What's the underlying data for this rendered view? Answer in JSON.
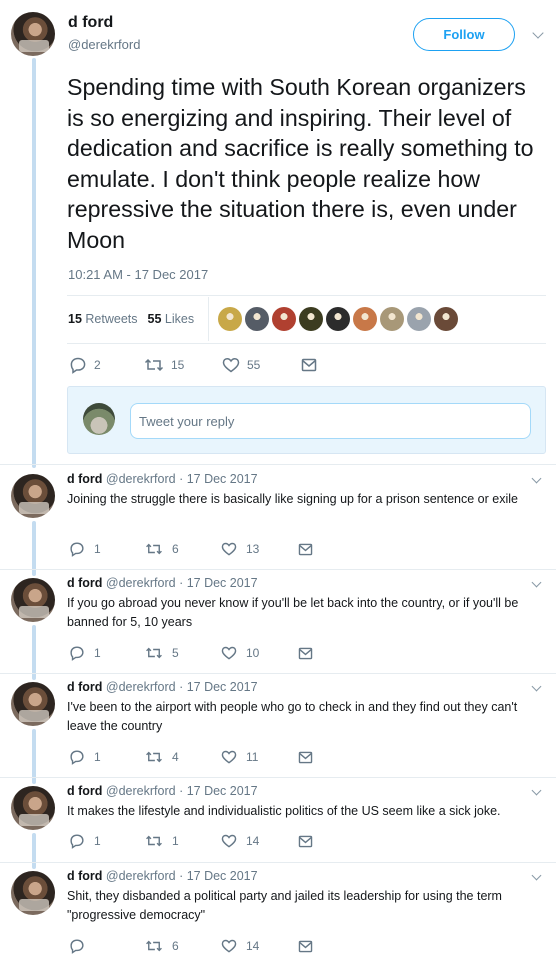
{
  "main_tweet": {
    "author_name": "d ford",
    "handle": "@derekrford",
    "follow_label": "Follow",
    "text": "Spending time with South Korean organizers is so energizing and inspiring. Their level of dedication and sacrifice is really something to emulate. I don't think people realize how repressive the situation there is, even under Moon",
    "timestamp": "10:21 AM - 17 Dec 2017",
    "retweets_count": "15",
    "retweets_label": "Retweets",
    "likes_count": "55",
    "likes_label": "Likes",
    "liker_colors": [
      "#c8a848",
      "#555c66",
      "#b04030",
      "#3c3c20",
      "#2c2c2c",
      "#c87848",
      "#a89878",
      "#9aa3ad",
      "#6a4a38"
    ],
    "actions": {
      "replies": "2",
      "retweets": "15",
      "likes": "55"
    }
  },
  "reply_composer": {
    "placeholder": "Tweet your reply"
  },
  "replies": [
    {
      "name": "d ford",
      "handle": "@derekrford",
      "date": "· 17 Dec 2017",
      "text": "Joining the struggle there is basically like signing up for a prison sentence or exile",
      "replies": "1",
      "retweets": "6",
      "likes": "13"
    },
    {
      "name": "d ford",
      "handle": "@derekrford",
      "date": "· 17 Dec 2017",
      "text": "If you go abroad you never know if you'll be let back into the country, or if you'll be banned for 5, 10 years",
      "replies": "1",
      "retweets": "5",
      "likes": "10"
    },
    {
      "name": "d ford",
      "handle": "@derekrford",
      "date": "· 17 Dec 2017",
      "text": "I've been to the airport with people who go to check in and they find out they can't leave the country",
      "replies": "1",
      "retweets": "4",
      "likes": "11"
    },
    {
      "name": "d ford",
      "handle": "@derekrford",
      "date": "· 17 Dec 2017",
      "text": "It makes the lifestyle and individualistic politics of the US seem like a sick joke.",
      "replies": "1",
      "retweets": "1",
      "likes": "14"
    },
    {
      "name": "d ford",
      "handle": "@derekrford",
      "date": "· 17 Dec 2017",
      "text": "Shit, they disbanded a political party and jailed its leadership for using the term \"progressive democracy\"",
      "replies": "",
      "retweets": "6",
      "likes": "14"
    }
  ],
  "icons": {
    "reply": "reply-icon",
    "retweet": "retweet-icon",
    "like": "heart-icon",
    "dm": "envelope-icon",
    "more": "chevron-down-icon"
  },
  "colors": {
    "accent": "#1da1f2",
    "thread_line": "#c4dcf0",
    "secondary_text": "#657786"
  }
}
